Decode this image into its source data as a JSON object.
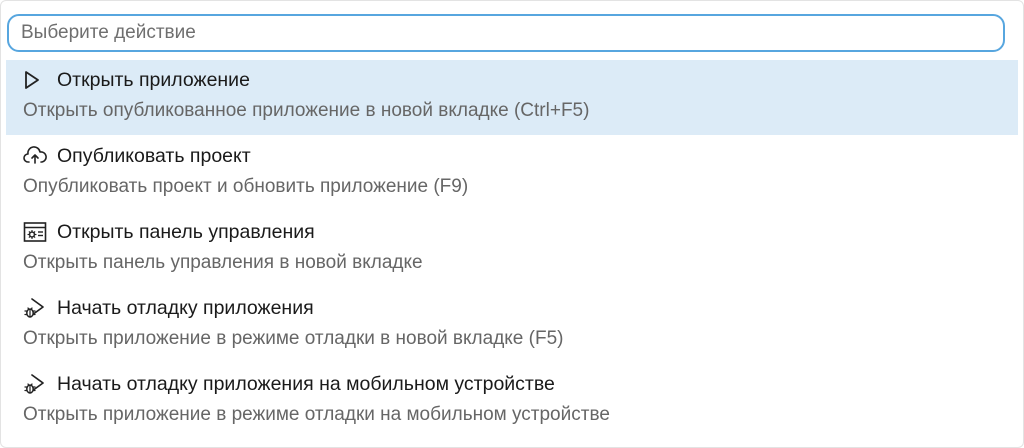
{
  "search": {
    "placeholder": "Выберите действие",
    "value": ""
  },
  "actions": [
    {
      "icon": "play-icon",
      "title": "Открыть приложение",
      "description": "Открыть опубликованное приложение в новой вкладке (Ctrl+F5)",
      "highlighted": true
    },
    {
      "icon": "cloud-upload-icon",
      "title": "Опубликовать проект",
      "description": "Опубликовать проект и обновить приложение (F9)",
      "highlighted": false
    },
    {
      "icon": "control-panel-icon",
      "title": "Открыть панель управления",
      "description": "Открыть панель управления в новой вкладке",
      "highlighted": false
    },
    {
      "icon": "debug-icon",
      "title": "Начать отладку приложения",
      "description": "Открыть приложение в режиме отладки в новой вкладке (F5)",
      "highlighted": false
    },
    {
      "icon": "debug-icon",
      "title": "Начать отладку приложения на мобильном устройстве",
      "description": "Открыть приложение в режиме отладки на мобильном устройстве",
      "highlighted": false
    }
  ],
  "colors": {
    "highlight": "#dcebf7",
    "search_border": "#57a6df",
    "title_text": "#1a1a1a",
    "description_text": "#666666"
  }
}
